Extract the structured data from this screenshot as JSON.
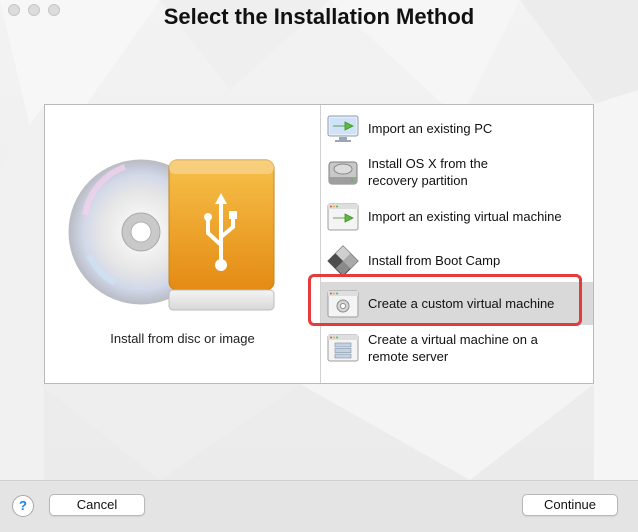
{
  "window": {
    "title": "Select the Installation Method"
  },
  "left_panel": {
    "label": "Install from disc or image",
    "icon": "disc-and-usb-drive-icon"
  },
  "options": [
    {
      "label": "Import an existing PC",
      "icon": "import-pc-icon"
    },
    {
      "label": "Install OS X from the\nrecovery partition",
      "icon": "hard-drive-icon"
    },
    {
      "label": "Import an existing virtual machine",
      "icon": "import-vm-icon"
    },
    {
      "label": "Install from Boot Camp",
      "icon": "boot-camp-icon"
    },
    {
      "label": "Create a custom virtual machine",
      "icon": "custom-vm-icon",
      "selected": true
    },
    {
      "label": "Create a virtual machine on a\nremote server",
      "icon": "remote-server-icon"
    }
  ],
  "footer": {
    "help_label": "?",
    "cancel_label": "Cancel",
    "continue_label": "Continue"
  },
  "colors": {
    "highlight": "#e23c3c",
    "selected_row": "#d9d9d9",
    "usb_orange": "#f0a020"
  }
}
